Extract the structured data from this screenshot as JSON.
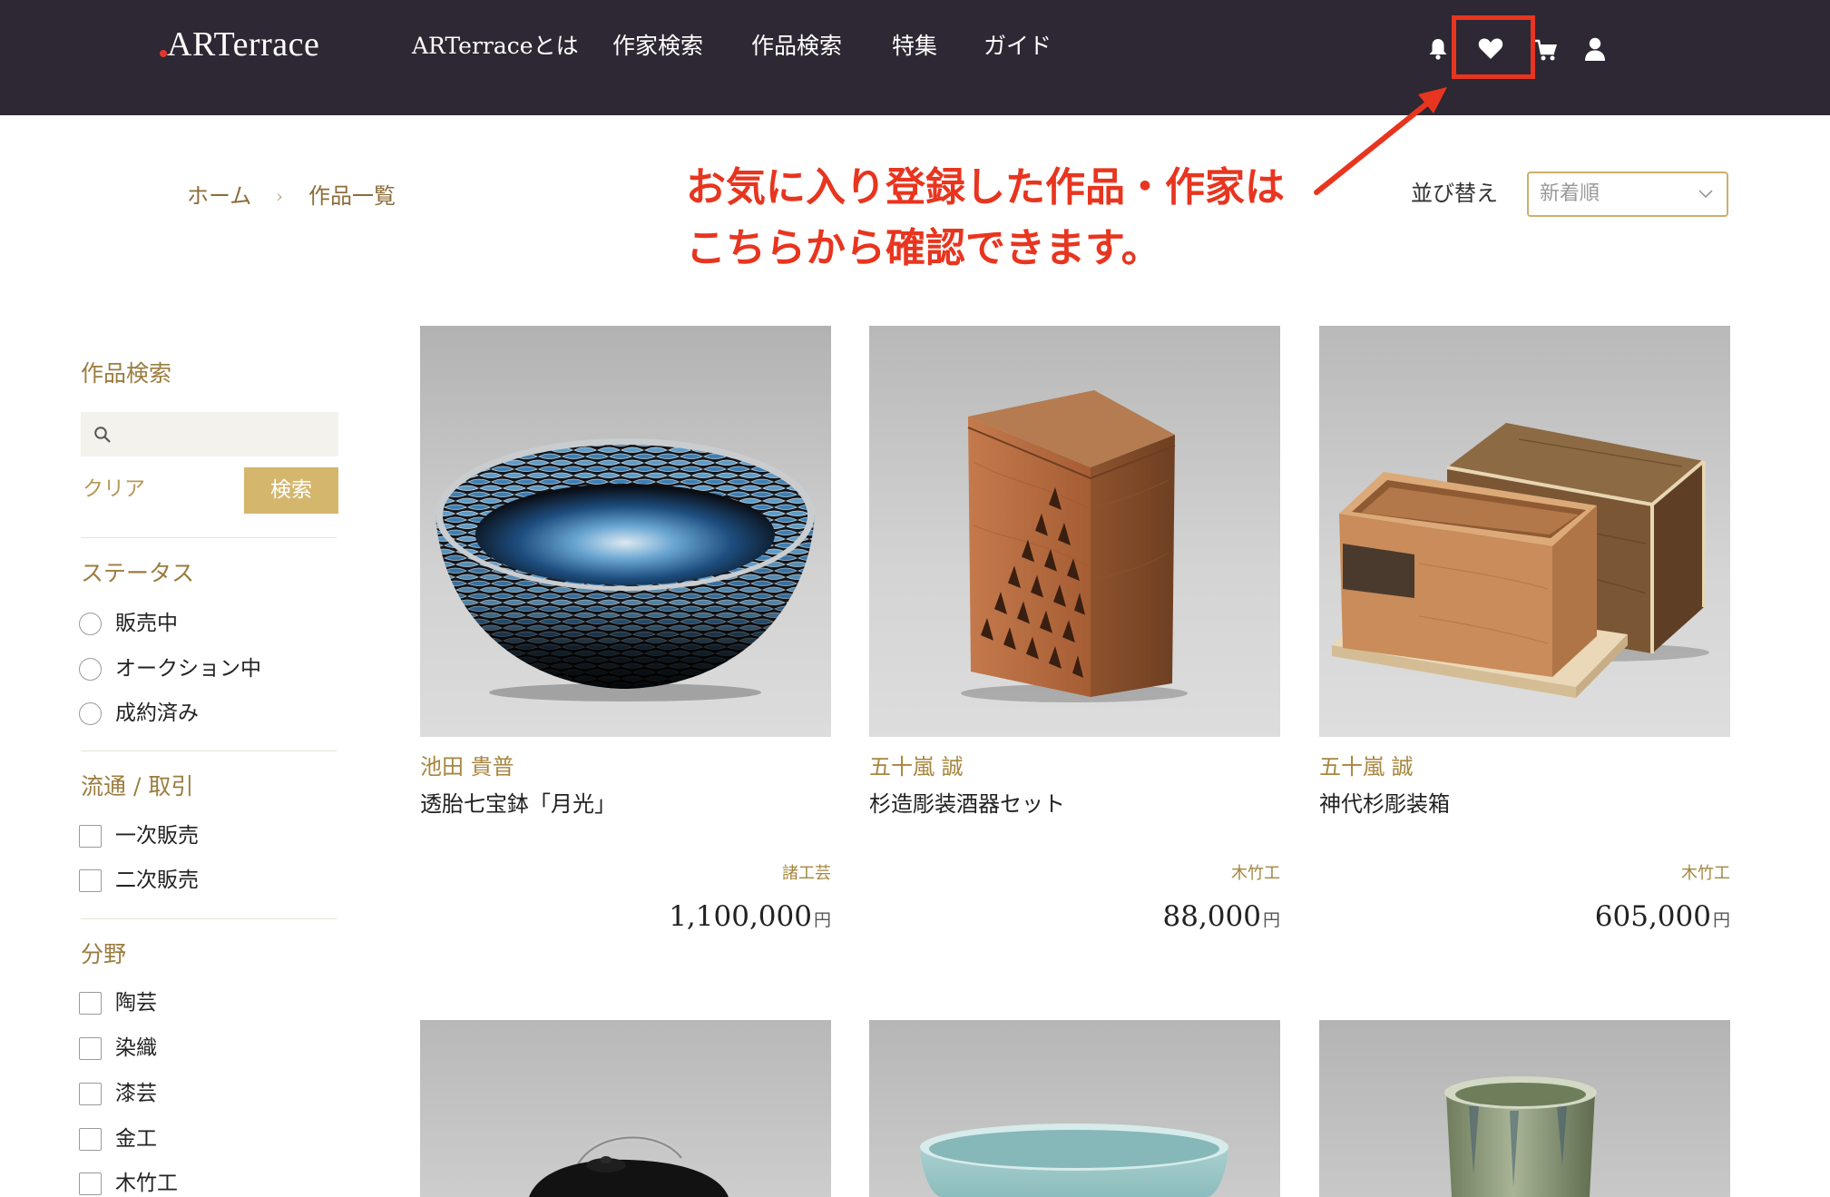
{
  "header": {
    "logo": "ARTerrace",
    "nav": [
      "ARTerraceとは",
      "作家検索",
      "作品検索",
      "特集",
      "ガイド"
    ],
    "icons": {
      "notifications": "bell-icon",
      "favorites": "heart-icon",
      "cart": "cart-icon",
      "account": "user-icon"
    }
  },
  "annotation": {
    "line1": "お気に入り登録した作品・作家は",
    "line2": "こちらから確認できます。"
  },
  "breadcrumb": {
    "items": [
      "ホーム",
      "作品一覧"
    ],
    "separator": "›"
  },
  "sort": {
    "label": "並び替え",
    "selected": "新着順"
  },
  "sidebar": {
    "search": {
      "heading": "作品検索",
      "clear_label": "クリア",
      "submit_label": "検索"
    },
    "status": {
      "heading": "ステータス",
      "options": [
        "販売中",
        "オークション中",
        "成約済み"
      ]
    },
    "distribution": {
      "heading": "流通 / 取引",
      "options": [
        "一次販売",
        "二次販売"
      ]
    },
    "genre": {
      "heading": "分野",
      "options": [
        "陶芸",
        "染織",
        "漆芸",
        "金工",
        "木竹工"
      ]
    }
  },
  "products": [
    {
      "artist": "池田 貴普",
      "title": "透胎七宝鉢「月光」",
      "category": "諸工芸",
      "price": "1,100,000",
      "currency": "円",
      "image": "cloisonne-bowl-image"
    },
    {
      "artist": "五十嵐 誠",
      "title": "杉造彫装酒器セット",
      "category": "木竹工",
      "price": "88,000",
      "currency": "円",
      "image": "carved-wooden-box-image"
    },
    {
      "artist": "五十嵐 誠",
      "title": "神代杉彫装箱",
      "category": "木竹工",
      "price": "605,000",
      "currency": "円",
      "image": "wooden-boxes-image"
    }
  ],
  "products_more": [
    {
      "image": "teapot-image"
    },
    {
      "image": "celadon-bowl-image"
    },
    {
      "image": "glazed-vase-image"
    }
  ],
  "colors": {
    "header_bg": "#2d2833",
    "accent_gold": "#d4b66d",
    "gold_text": "#9b7c3f",
    "annotation_red": "#e8351f"
  }
}
